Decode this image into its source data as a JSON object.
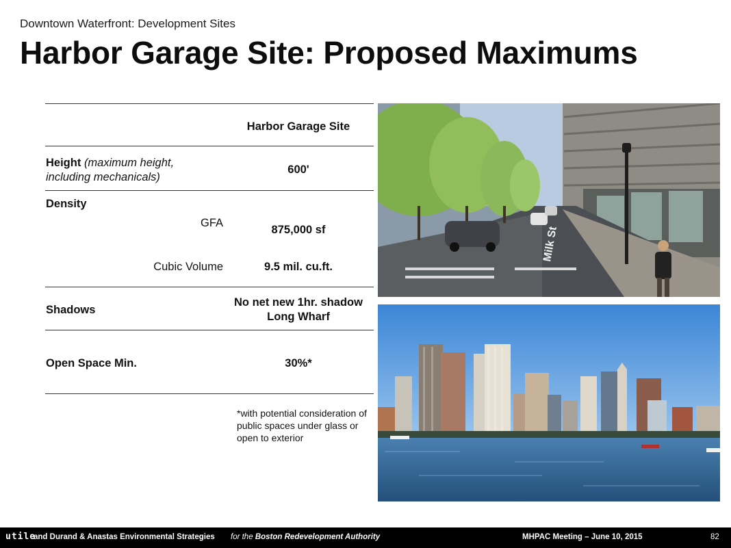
{
  "header": {
    "subtitle": "Downtown Waterfront: Development Sites",
    "title": "Harbor Garage Site: Proposed Maximums"
  },
  "table": {
    "column_header": "Harbor Garage Site",
    "height": {
      "label": "Height",
      "label_note_line1": "(maximum height,",
      "label_note_line2": "including mechanicals)",
      "value": "600'"
    },
    "density": {
      "label": "Density",
      "gfa_label": "GFA",
      "gfa_value": "875,000 sf",
      "volume_label": "Cubic Volume",
      "volume_value": "9.5 mil. cu.ft."
    },
    "shadows": {
      "label": "Shadows",
      "value_line1": "No net new 1hr. shadow",
      "value_line2": "Long Wharf"
    },
    "open_space": {
      "label": "Open Space Min.",
      "value": "30%*"
    }
  },
  "footnote": "*with potential consideration of public spaces under glass or open to exterior",
  "images": {
    "top": {
      "street_sign": "Milk St"
    },
    "bottom": "boston-skyline-harbor-photo"
  },
  "footer": {
    "brand": "utile",
    "partners": "and Durand & Anastas Environmental Strategies",
    "for_prefix": "for the",
    "for_org": "Boston Redevelopment Authority",
    "meeting": "MHPAC Meeting  – June 10, 2015",
    "page": "82"
  },
  "colors": {
    "footer_bg": "#000000",
    "rule": "#333333",
    "text": "#111111"
  }
}
